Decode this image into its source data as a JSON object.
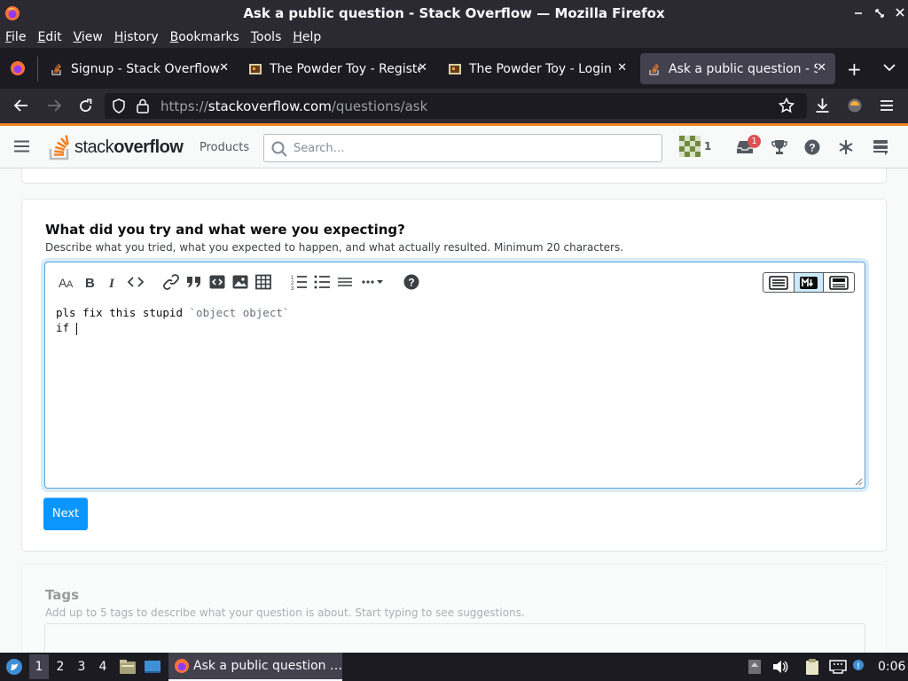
{
  "window": {
    "title": "Ask a public question - Stack Overflow — Mozilla Firefox"
  },
  "menu": [
    {
      "label": "File",
      "key": "F",
      "rest": "ile"
    },
    {
      "label": "Edit",
      "key": "E",
      "rest": "dit"
    },
    {
      "label": "View",
      "key": "V",
      "rest": "iew"
    },
    {
      "label": "History",
      "key": "H",
      "rest": "istory"
    },
    {
      "label": "Bookmarks",
      "key": "B",
      "rest": "ookmarks"
    },
    {
      "label": "Tools",
      "key": "T",
      "rest": "ools"
    },
    {
      "label": "Help",
      "key": "H",
      "rest": "elp"
    }
  ],
  "tabs": [
    {
      "label": "Signup - Stack Overflow",
      "icon": "stackoverflow-icon",
      "active": false
    },
    {
      "label": "The Powder Toy - Registe",
      "icon": "powder-toy-icon",
      "active": false
    },
    {
      "label": "The Powder Toy - Login",
      "icon": "powder-toy-icon",
      "active": false
    },
    {
      "label": "Ask a public question - St",
      "icon": "stackoverflow-icon",
      "active": true
    }
  ],
  "url": {
    "prefix": "https://",
    "domain": "stackoverflow.com",
    "path": "/questions/ask"
  },
  "so": {
    "logo_text_light": "stack",
    "logo_text_bold": "overflow",
    "products": "Products",
    "search_placeholder": "Search…",
    "reputation": "1",
    "inbox_badge": "1"
  },
  "section": {
    "title": "What did you try and what were you expecting?",
    "description": "Describe what you tried, what you expected to happen, and what actually resulted. Minimum 20 characters."
  },
  "editor": {
    "line1_text": "pls fix this stupid ",
    "line1_code": "`object object`",
    "line2_text": "if "
  },
  "next_button": "Next",
  "tags": {
    "title": "Tags",
    "description": "Add up to 5 tags to describe what your question is about. Start typing to see suggestions."
  },
  "taskbar": {
    "workspaces": [
      "1",
      "2",
      "3",
      "4"
    ],
    "active_window": "Ask a public question …",
    "clock": "0:06"
  },
  "colors": {
    "accent": "#0a95ff",
    "so_orange": "#f48225",
    "firefox_dark": "#2b2a33"
  }
}
